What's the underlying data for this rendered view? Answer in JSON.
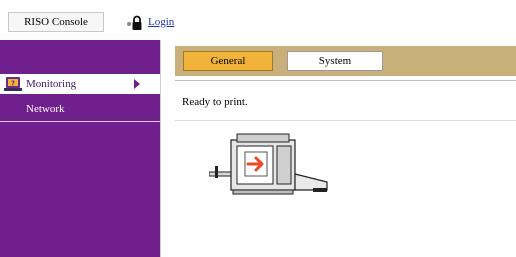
{
  "header": {
    "app_title": "RISO Console",
    "login_label": "Login",
    "icons": [
      "lock-icon"
    ]
  },
  "sidebar": {
    "items": [
      {
        "label": "Monitoring",
        "icon": "monitor-question-icon",
        "selected": true
      },
      {
        "label": "Network",
        "selected": false
      }
    ]
  },
  "main": {
    "tabs": [
      {
        "label": "General",
        "active": true
      },
      {
        "label": "System",
        "active": false
      }
    ],
    "status": "Ready to print.",
    "printer_icon": "printer-ready-icon"
  },
  "colors": {
    "sidebar": "#70208d",
    "tab_bar": "#c9b07a",
    "tab_active": "#f1b33a",
    "link": "#1a33b8",
    "printer_arrow": "#ef4a23"
  }
}
